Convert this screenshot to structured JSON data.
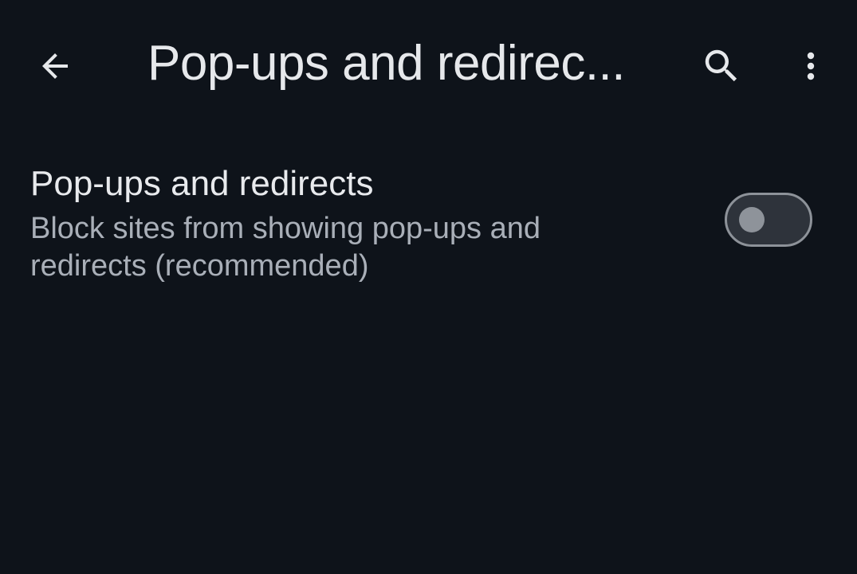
{
  "app_bar": {
    "title": "Pop-ups and redirec...",
    "back_icon": "arrow-back-icon",
    "search_icon": "search-icon",
    "more_icon": "more-vert-icon"
  },
  "setting": {
    "title": "Pop-ups and redirects",
    "summary": "Block sites from showing pop-ups and redirects (recommended)",
    "toggle_checked": false
  },
  "colors": {
    "background": "#0e131a",
    "primary_text": "#e8eaed",
    "secondary_text": "#a9afb8",
    "toggle_track": "#2e333b",
    "toggle_outline": "#8d9299",
    "toggle_thumb": "#8e939a"
  }
}
